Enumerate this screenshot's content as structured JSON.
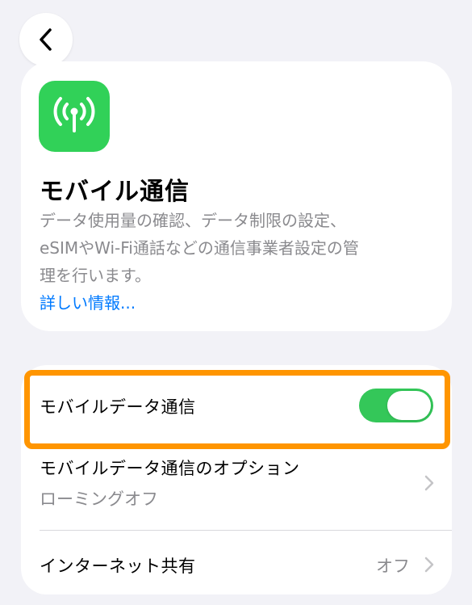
{
  "nav": {
    "back_icon": "chevron-left-icon"
  },
  "header": {
    "app_icon": "antenna-icon",
    "icon_color": "#31d158",
    "title": "モバイル通信",
    "description_line1": "データ使用量の確認、データ制限の設定、",
    "description_line2": "eSIMやWi-Fi通話などの通信事業者設定の管",
    "description_line3": "理を行います。",
    "more_link": "詳しい情報..."
  },
  "settings": {
    "mobile_data": {
      "label": "モバイルデータ通信",
      "toggle_on": true,
      "toggle_color": "#34c759"
    },
    "options": {
      "label": "モバイルデータ通信のオプション",
      "subtitle": "ローミングオフ"
    },
    "hotspot": {
      "label": "インターネット共有",
      "value": "オフ"
    }
  },
  "colors": {
    "highlight": "#ff9500",
    "link": "#007aff",
    "background": "#f2f2f7"
  }
}
